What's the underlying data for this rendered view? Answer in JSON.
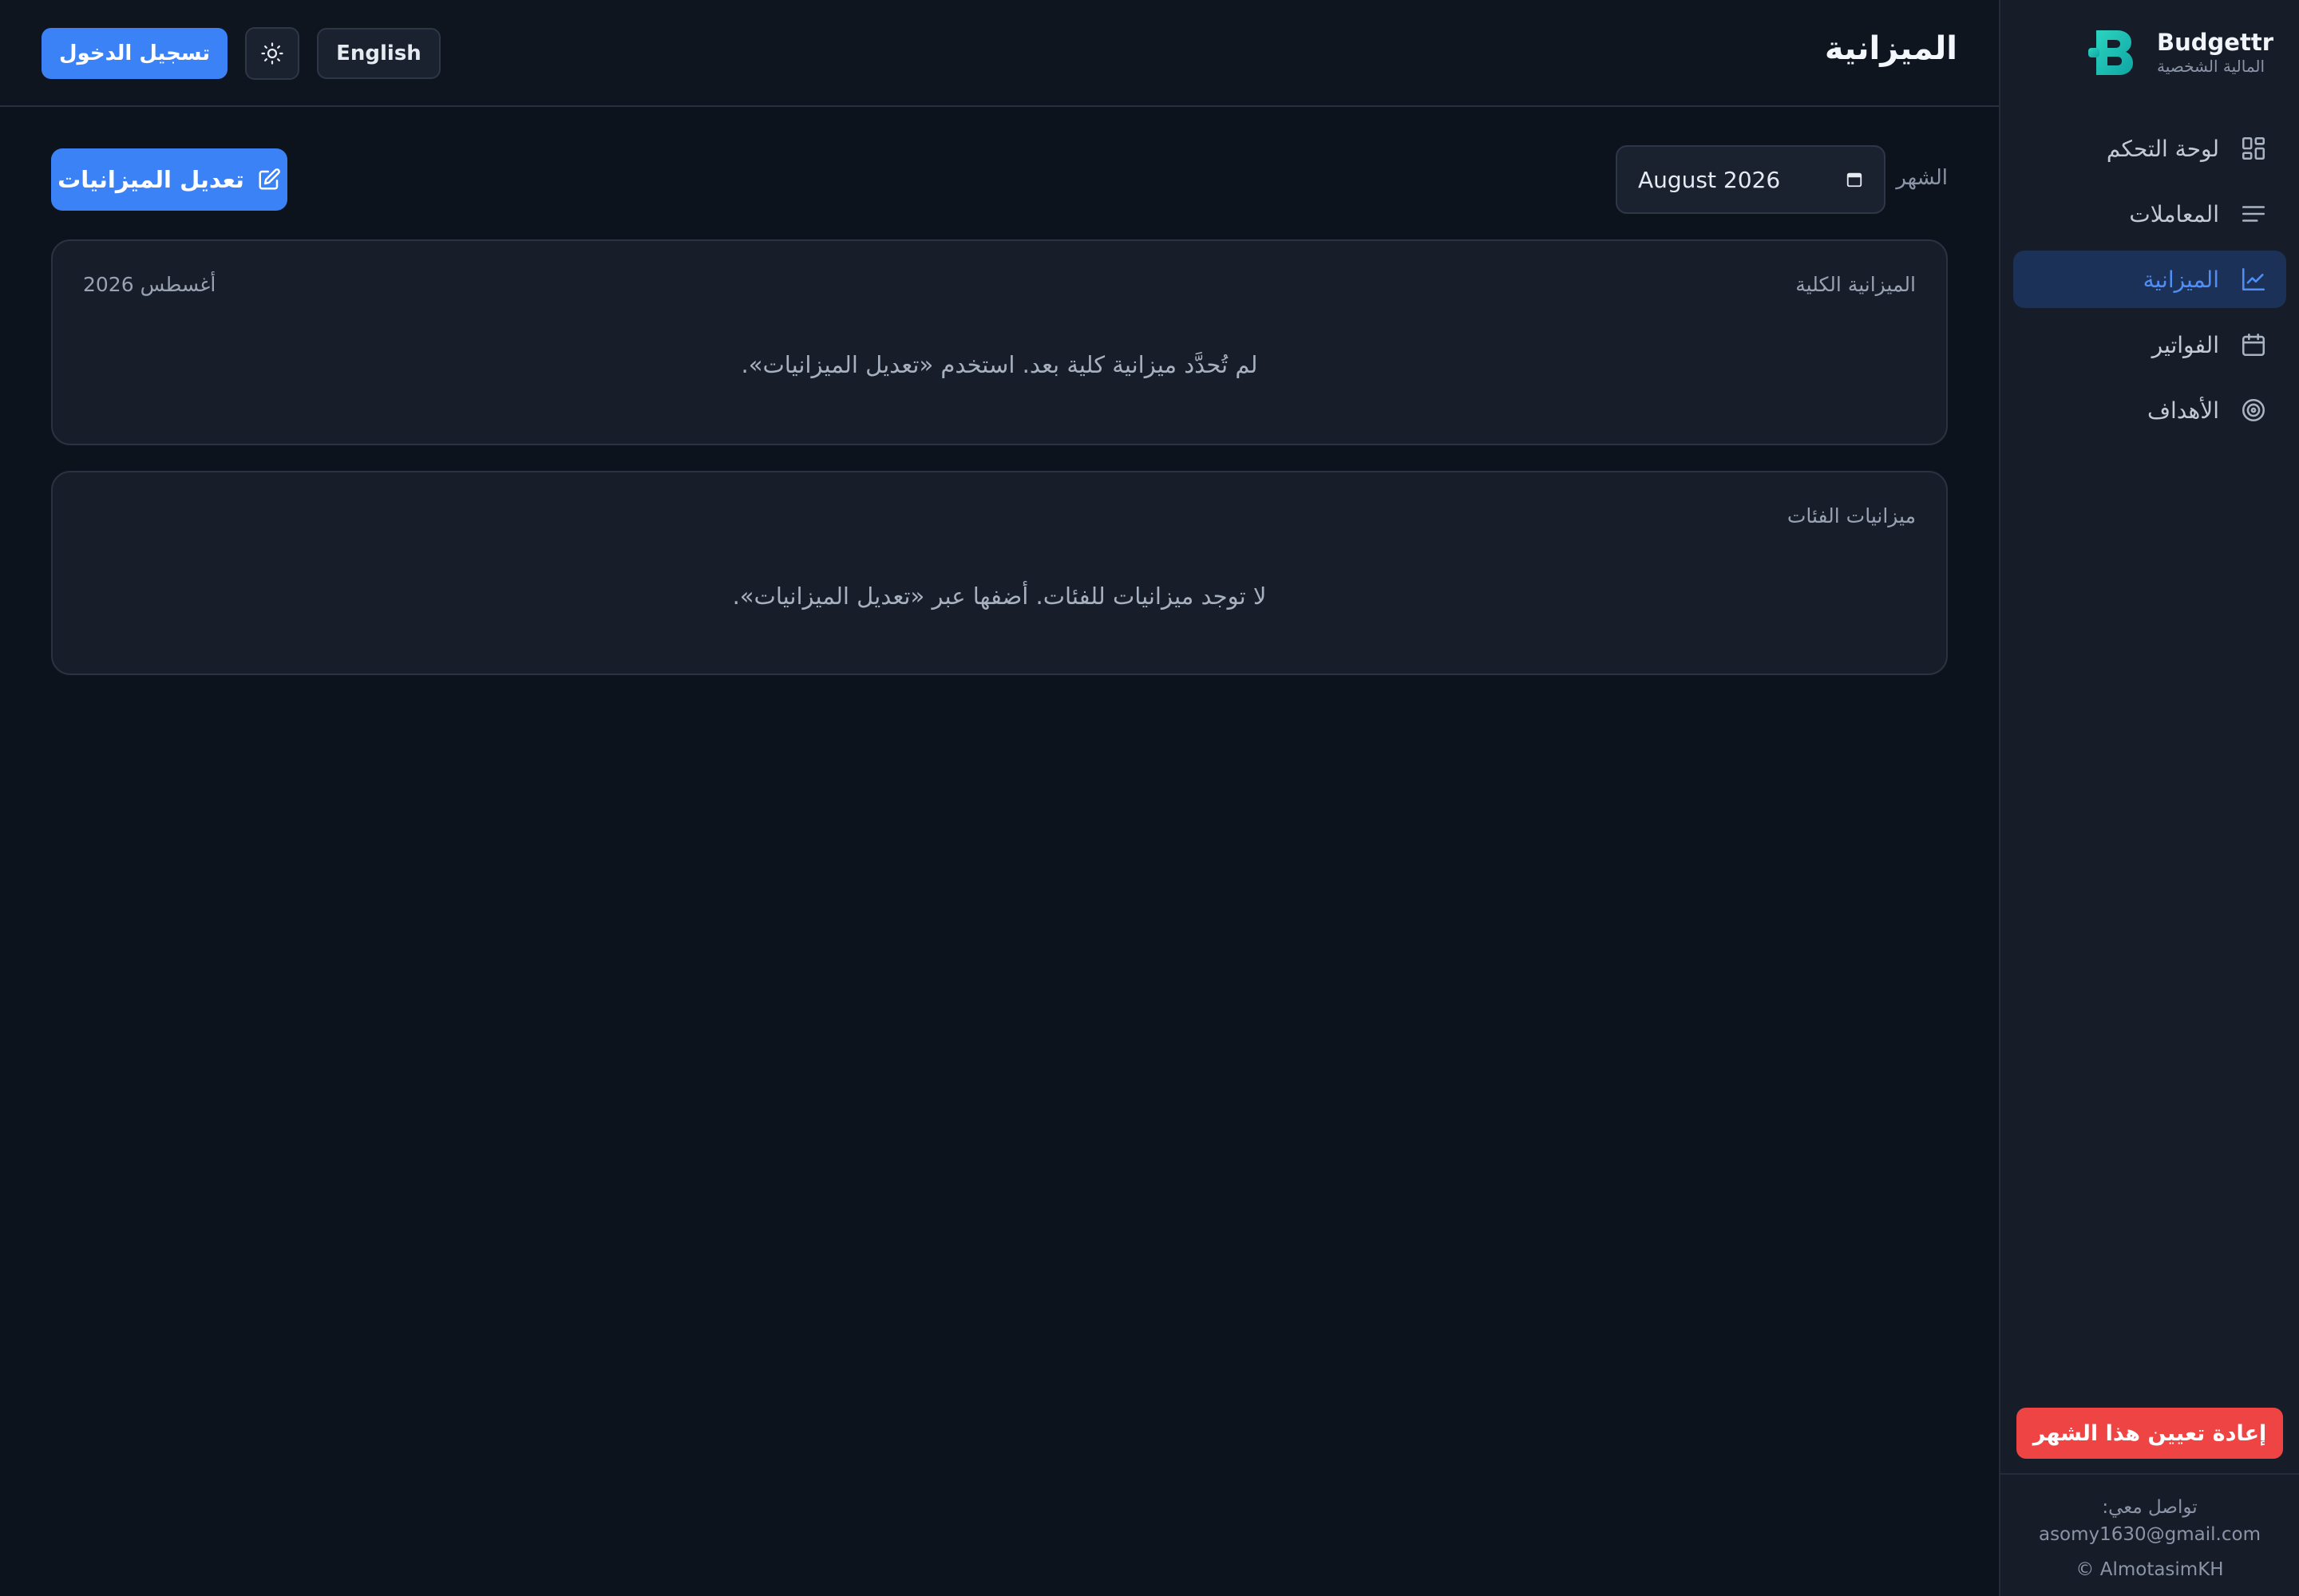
{
  "sidebar": {
    "brand_name": "Budgettr",
    "brand_subtitle": "المالية الشخصية",
    "brand_logo_icon": "budgettr-logo",
    "items": [
      {
        "label": "لوحة التحكم",
        "icon": "dashboard-grid-icon",
        "active": false
      },
      {
        "label": "المعاملات",
        "icon": "list-lines-icon",
        "active": false
      },
      {
        "label": "الميزانية",
        "icon": "chart-line-icon",
        "active": true
      },
      {
        "label": "الفواتير",
        "icon": "calendar-icon",
        "active": false
      },
      {
        "label": "الأهداف",
        "icon": "target-icon",
        "active": false
      }
    ],
    "reset_label": "إعادة تعيين هذا الشهر",
    "contact_label": "تواصل معي:",
    "contact_email": "asomy1630@gmail.com",
    "copyright": "© AlmotasimKH"
  },
  "header": {
    "title": "الميزانية",
    "login_label": "تسجيل الدخول",
    "theme_icon": "sun-icon",
    "language_label": "English"
  },
  "toolbar": {
    "month_label": "الشهر",
    "month_value": "August 2026",
    "edit_label": "تعديل الميزانيات"
  },
  "total_budget": {
    "title": "الميزانية الكلية",
    "date": "أغسطس 2026",
    "empty_message": "لم تُحدَّد ميزانية كلية بعد. استخدم «تعديل الميزانيات»."
  },
  "category_budgets": {
    "title": "ميزانيات الفئات",
    "empty_message": "لا توجد ميزانيات للفئات. أضفها عبر «تعديل الميزانيات»."
  },
  "colors": {
    "background": "#0d131c",
    "sidebar": "#161d29",
    "accent": "#3b82f6",
    "active_nav_bg": "#1c3157",
    "danger": "#ef4444",
    "logo": "#22c1b6"
  }
}
